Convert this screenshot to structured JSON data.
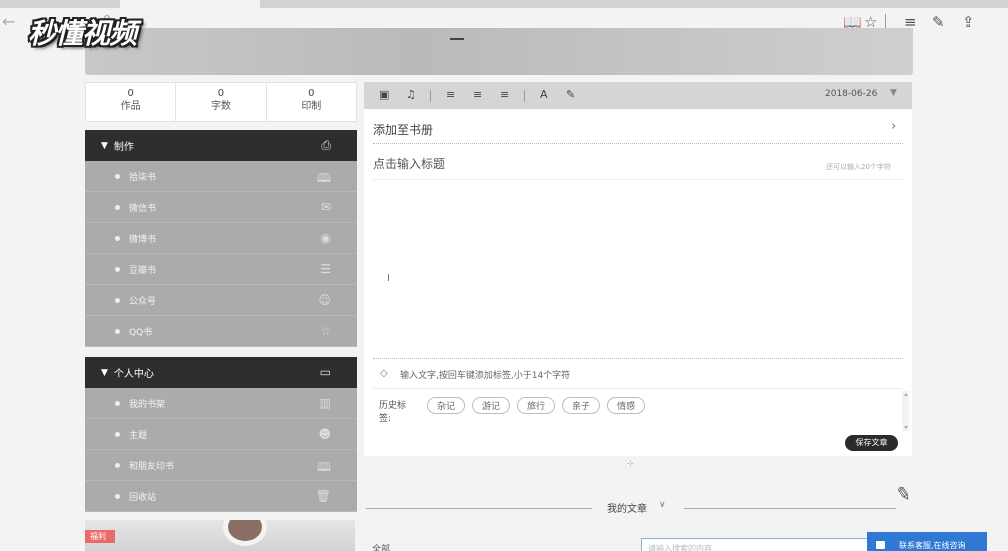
{
  "browser": {
    "toolbar_icons": [
      "reading-view-icon",
      "favorite-star-icon",
      "hub-icon",
      "notes-icon",
      "share-icon"
    ]
  },
  "watermark": {
    "text": "秒懂视频"
  },
  "stats": [
    {
      "value": "0",
      "label": "作品"
    },
    {
      "value": "0",
      "label": "字数"
    },
    {
      "value": "0",
      "label": "印制"
    }
  ],
  "sidebar": {
    "section_create": {
      "title": "制作",
      "items": [
        {
          "label": "拾柒书"
        },
        {
          "label": "微信书"
        },
        {
          "label": "微博书"
        },
        {
          "label": "豆瓣书"
        },
        {
          "label": "公众号"
        },
        {
          "label": "QQ书"
        }
      ]
    },
    "section_personal": {
      "title": "个人中心",
      "items": [
        {
          "label": "我的书架"
        },
        {
          "label": "主题"
        },
        {
          "label": "和朋友印书"
        },
        {
          "label": "回收站"
        }
      ]
    },
    "promo": {
      "ribbon": "福利"
    }
  },
  "editor": {
    "date": "2018-06-26",
    "add_to_book": "添加至书册",
    "title_placeholder": "点击输入标题",
    "title_hint": "还可以输入20个字符",
    "tag_placeholder": "输入文字,按回车键添加标签,小于14个字符",
    "history_label": "历史标签:",
    "history_tags": [
      "杂记",
      "游记",
      "旅行",
      "亲子",
      "情感"
    ],
    "save_button": "保存文章"
  },
  "articles": {
    "label": "我的文章"
  },
  "bottom": {
    "left_label": "全部",
    "search_placeholder": "请输入搜索的内容",
    "chat_label": "联系客服,在线咨询"
  },
  "colors": {
    "sidebar_header": "#2e2e2e",
    "sidebar_item": "#ababab",
    "toolbar": "#d5d5d5",
    "chat": "#2f78d4",
    "ribbon": "#e96a6a"
  }
}
